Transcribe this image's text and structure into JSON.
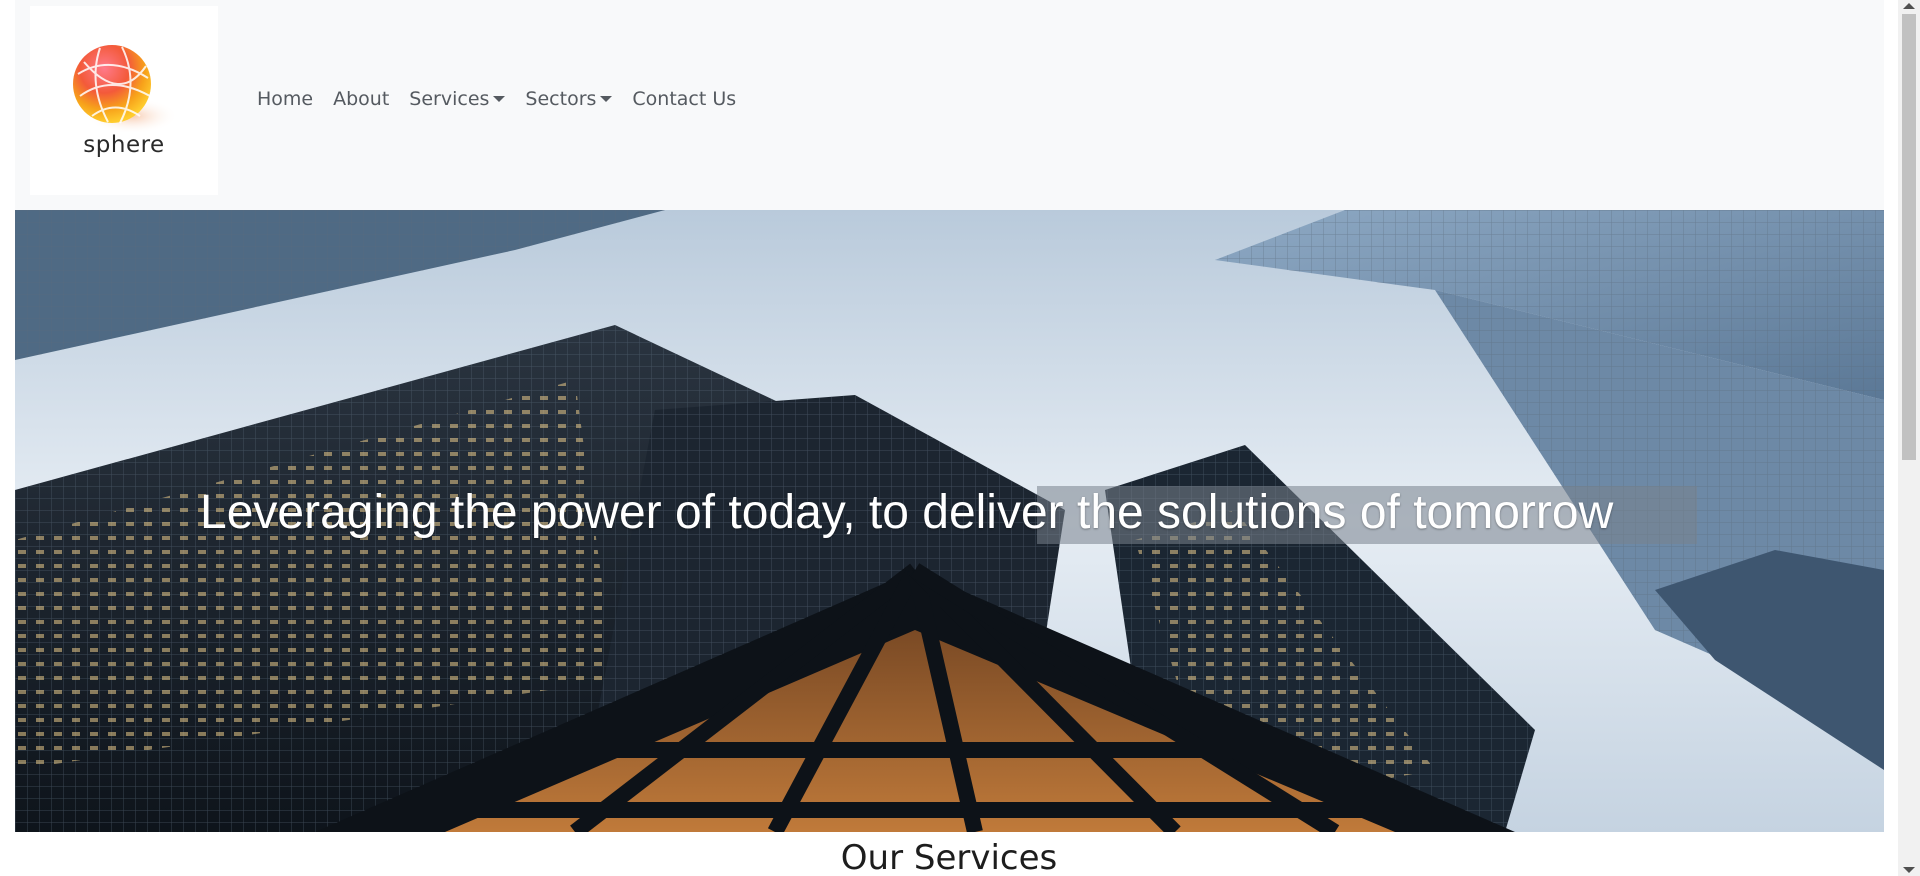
{
  "brand": {
    "name": "sphere"
  },
  "nav": {
    "items": [
      {
        "label": "Home",
        "dropdown": false
      },
      {
        "label": "About",
        "dropdown": false
      },
      {
        "label": "Services",
        "dropdown": true
      },
      {
        "label": "Sectors",
        "dropdown": true
      },
      {
        "label": "Contact Us",
        "dropdown": false
      }
    ]
  },
  "hero": {
    "headline": "Leveraging the power of today, to deliver the solutions of tomorrow"
  },
  "services": {
    "title": "Our Services"
  },
  "colors": {
    "navbar_bg": "#f8f9fa",
    "nav_text": "#555a60",
    "hero_text": "#ffffff",
    "logo_orange": "#f7a11a",
    "logo_red": "#e8343e"
  }
}
